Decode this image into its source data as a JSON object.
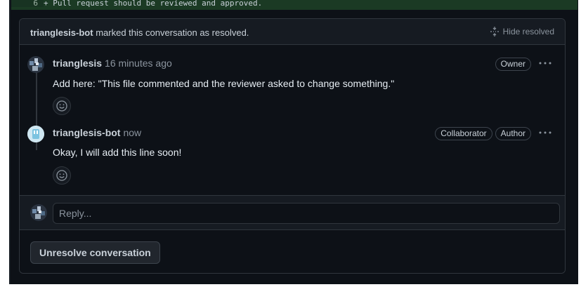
{
  "diff": {
    "line_number": "6",
    "code": "+ Pull request should be reviewed and approved."
  },
  "thread": {
    "resolved_by": "trianglesis-bot",
    "resolved_text": "marked this conversation as resolved.",
    "hide_resolved_label": "Hide resolved",
    "comments": [
      {
        "author": "trianglesis",
        "time": "16 minutes ago",
        "badges": [
          "Owner"
        ],
        "body": "Add here: \"This file commented and the reviewer asked to change something.\"",
        "avatar_icon": "user-avatar-icon"
      },
      {
        "author": "trianglesis-bot",
        "time": "now",
        "badges": [
          "Collaborator",
          "Author"
        ],
        "body": "Okay, I will add this line soon!",
        "avatar_icon": "bot-avatar-icon"
      }
    ],
    "reply_placeholder": "Reply...",
    "unresolve_label": "Unresolve conversation"
  },
  "colors": {
    "background": "#0d1117",
    "panel": "#161b22",
    "border": "#30363d",
    "text": "#e6edf3",
    "muted": "#8b949e"
  }
}
